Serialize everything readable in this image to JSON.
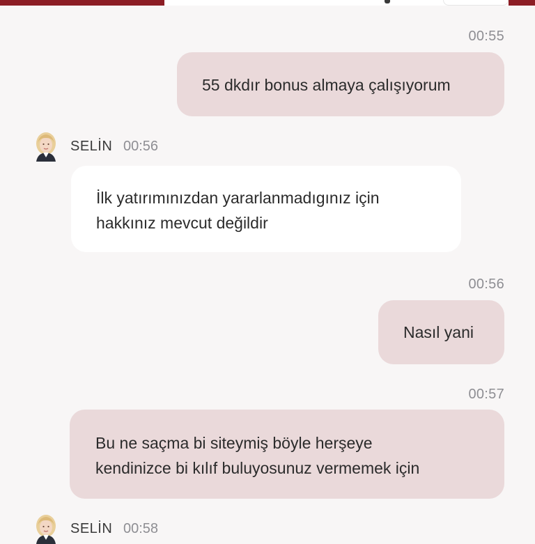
{
  "messages": [
    {
      "sender": "user",
      "time": "00:55",
      "text": "55 dkdır bonus almaya çalışıyorum"
    },
    {
      "sender": "agent",
      "name": "SELİN",
      "time": "00:56",
      "lines": [
        "İlk yatırımınızdan yararlanmadıgınız için",
        "hakkınız mevcut değildir"
      ]
    },
    {
      "sender": "user",
      "time": "00:56",
      "text": "Nasıl yani"
    },
    {
      "sender": "user",
      "time": "00:57",
      "lines": [
        "Bu ne saçma bi siteymiş böyle herşeye",
        "kendinizce bi kılıf buluyosunuz vermemek için"
      ]
    },
    {
      "sender": "agent",
      "name": "SELİN",
      "time": "00:58"
    }
  ],
  "colors": {
    "header_red": "#8c1d24",
    "user_bubble": "#ead9da",
    "agent_bubble": "#ffffff",
    "background": "#f8f6f6",
    "timestamp": "#8e8e93"
  },
  "icons": {
    "agent_avatar": "agent-avatar-icon"
  }
}
